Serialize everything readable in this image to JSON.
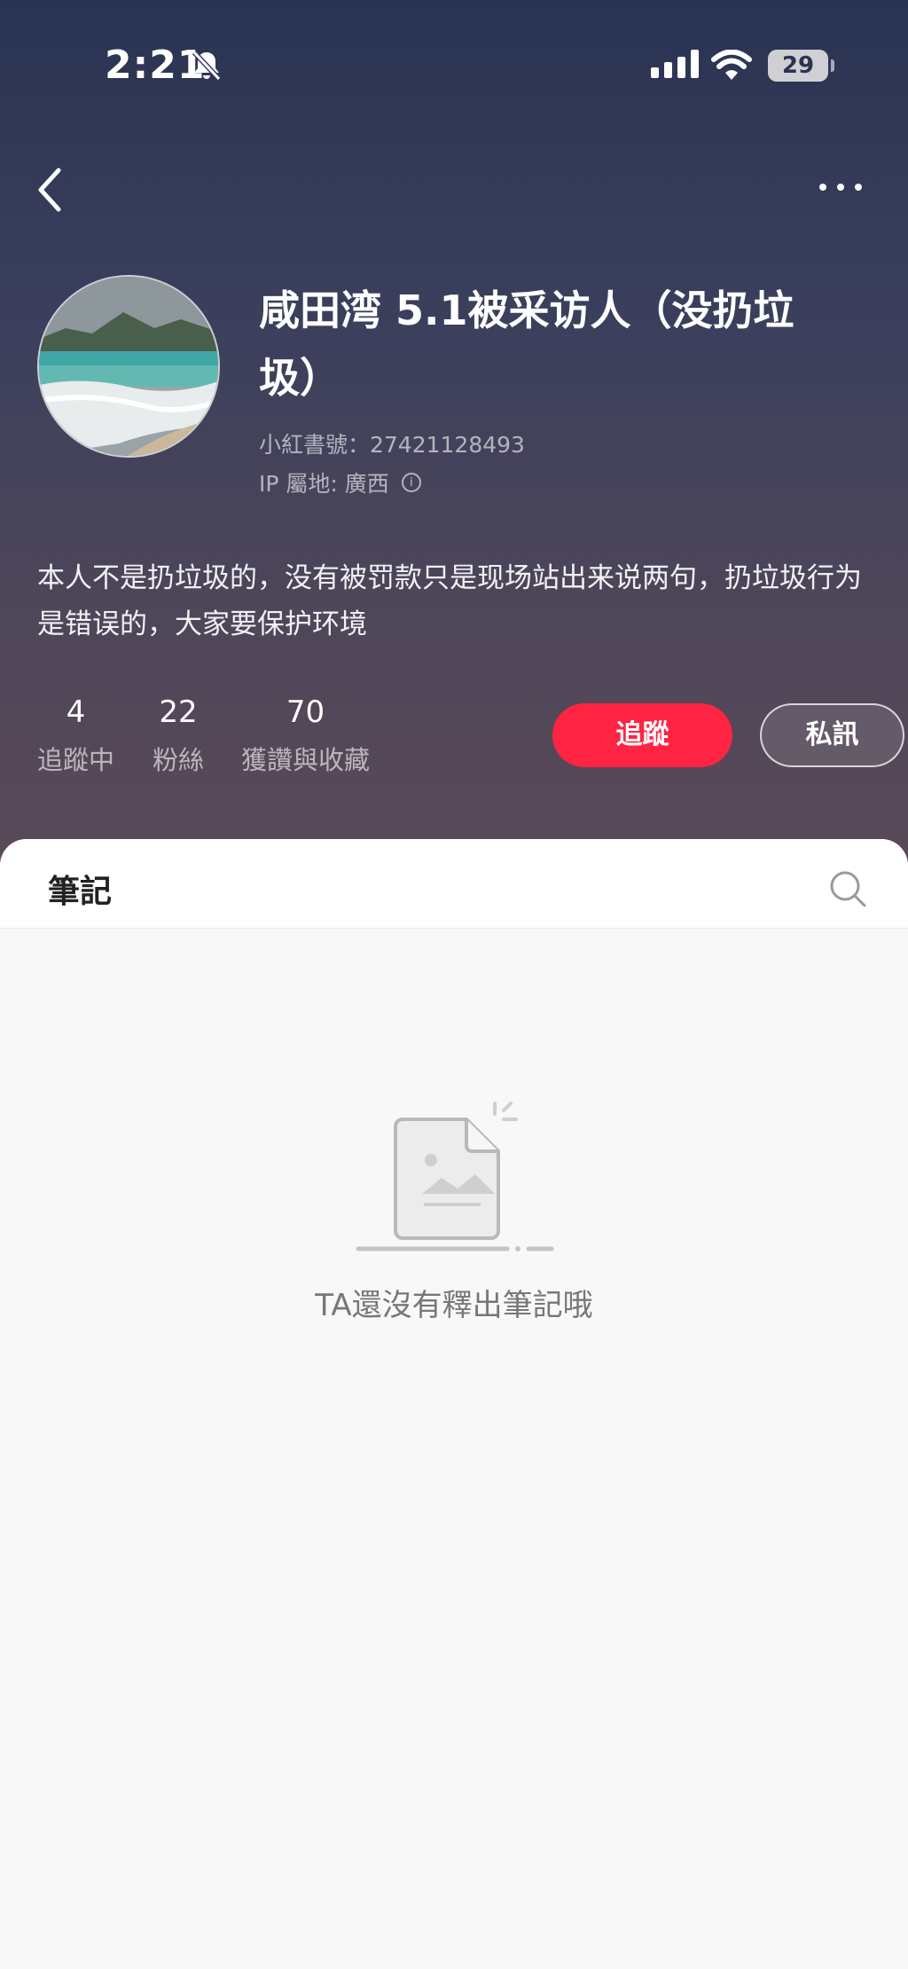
{
  "status_bar": {
    "time": "2:21",
    "battery": "29",
    "icons": [
      "bell-slash-icon",
      "cellular-signal-icon",
      "wifi-icon",
      "battery-icon"
    ]
  },
  "nav": {
    "back_icon": "chevron-left-icon",
    "more_icon": "ellipsis-icon"
  },
  "profile": {
    "name": "咸田湾 5.1被采访人（没扔垃圾）",
    "id_text": "小紅書號：27421128493",
    "ip_text": "IP 屬地: 廣西",
    "bio": "本人不是扔垃圾的，没有被罚款只是现场站出来说两句，扔垃圾行为是错误的，大家要保护环境"
  },
  "stats": [
    {
      "value": "4",
      "label": "追蹤中"
    },
    {
      "value": "22",
      "label": "粉絲"
    },
    {
      "value": "70",
      "label": "獲讚與收藏"
    }
  ],
  "actions": {
    "follow_label": "追蹤",
    "message_label": "私訊"
  },
  "tabs": {
    "notes_label": "筆記"
  },
  "empty_state": {
    "text": "TA還沒有釋出筆記哦"
  },
  "colors": {
    "accent": "#ff2442",
    "header_top": "#2a3352",
    "header_bottom": "#5a4a58"
  }
}
